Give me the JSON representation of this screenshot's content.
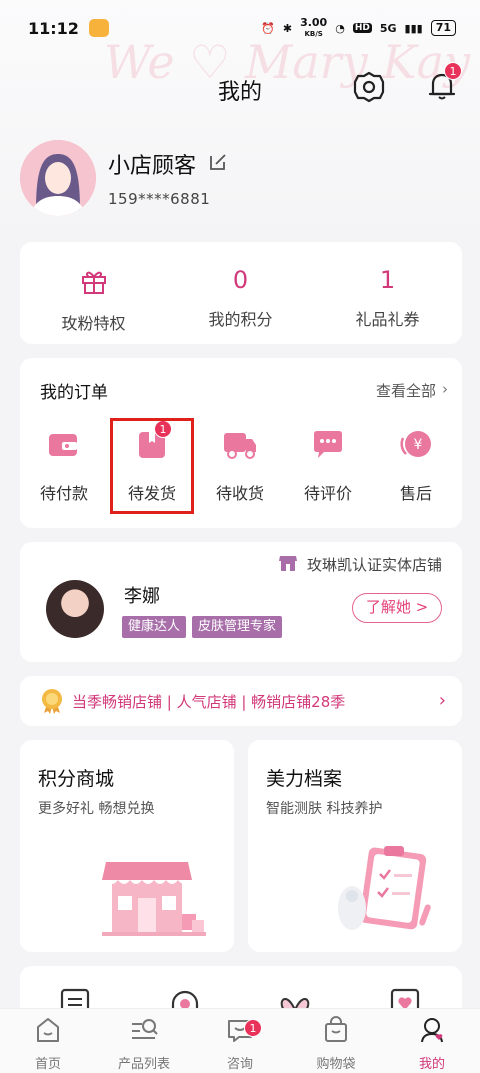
{
  "status_bar": {
    "time": "11:12",
    "net_speed": "3.00",
    "net_unit": "KB/S",
    "hd": "HD",
    "signal": "5G",
    "battery": "71"
  },
  "header": {
    "title": "我的",
    "watermark": "We ♡ Mary Kay",
    "notification_count": "1"
  },
  "profile": {
    "name": "小店顾客",
    "phone": "159****6881"
  },
  "stats": [
    {
      "value": "",
      "label": "玫粉特权",
      "icon": "gift-icon"
    },
    {
      "value": "0",
      "label": "我的积分"
    },
    {
      "value": "1",
      "label": "礼品礼券"
    }
  ],
  "orders": {
    "title": "我的订单",
    "view_all": "查看全部",
    "items": [
      {
        "label": "待付款",
        "icon": "wallet-icon"
      },
      {
        "label": "待发货",
        "icon": "package-icon",
        "badge": "1"
      },
      {
        "label": "待收货",
        "icon": "truck-icon"
      },
      {
        "label": "待评价",
        "icon": "comment-icon"
      },
      {
        "label": "售后",
        "icon": "yuan-refund-icon"
      }
    ]
  },
  "store": {
    "cert": "玫琳凯认证实体店铺",
    "consultant": "李娜",
    "tags": [
      "健康达人",
      "皮肤管理专家"
    ],
    "button": "了解她 >"
  },
  "promo": {
    "text": "当季畅销店铺 | 人气店铺 | 畅销店铺28季"
  },
  "features": [
    {
      "title": "积分商城",
      "subtitle": "更多好礼 畅想兑换"
    },
    {
      "title": "美力档案",
      "subtitle": "智能测肤 科技养护"
    }
  ],
  "tabbar": [
    {
      "label": "首页"
    },
    {
      "label": "产品列表"
    },
    {
      "label": "咨询",
      "badge": "1"
    },
    {
      "label": "购物袋"
    },
    {
      "label": "我的"
    }
  ],
  "colors": {
    "accent": "#d2397a",
    "badge": "#e8325a",
    "highlight": "#e0201a"
  }
}
